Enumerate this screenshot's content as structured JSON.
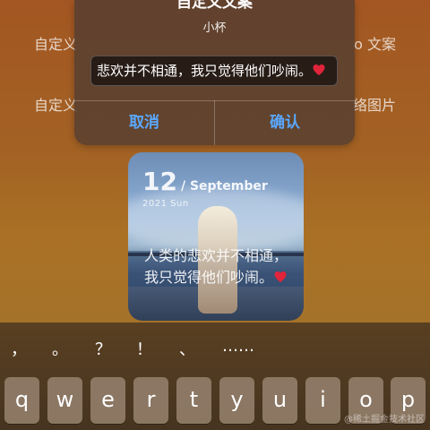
{
  "background_options": {
    "row1_left": "自定义",
    "row1_right": "o 文案",
    "row2_left": "自定义",
    "row2_right": "络图片"
  },
  "dialog": {
    "title": "自定义文案",
    "subtitle": "小杯",
    "input_value": "悲欢并不相通，我只觉得他们吵闹。",
    "cancel_label": "取消",
    "confirm_label": "确认",
    "accent_color": "#5aa8ff"
  },
  "card": {
    "day": "12",
    "month": "/ September",
    "year_day": "2021  Sun",
    "text": "人类的悲欢并不相通，我只觉得他们吵闹。"
  },
  "keyboard": {
    "punctuation": [
      "，",
      "。",
      "？",
      "！",
      "、",
      "……"
    ],
    "keys": [
      "q",
      "w",
      "e",
      "r",
      "t",
      "y",
      "u",
      "i",
      "o",
      "p"
    ]
  },
  "watermark": "@稀土掘金技术社区",
  "icons": {
    "heart": "heart-emoji-icon"
  }
}
